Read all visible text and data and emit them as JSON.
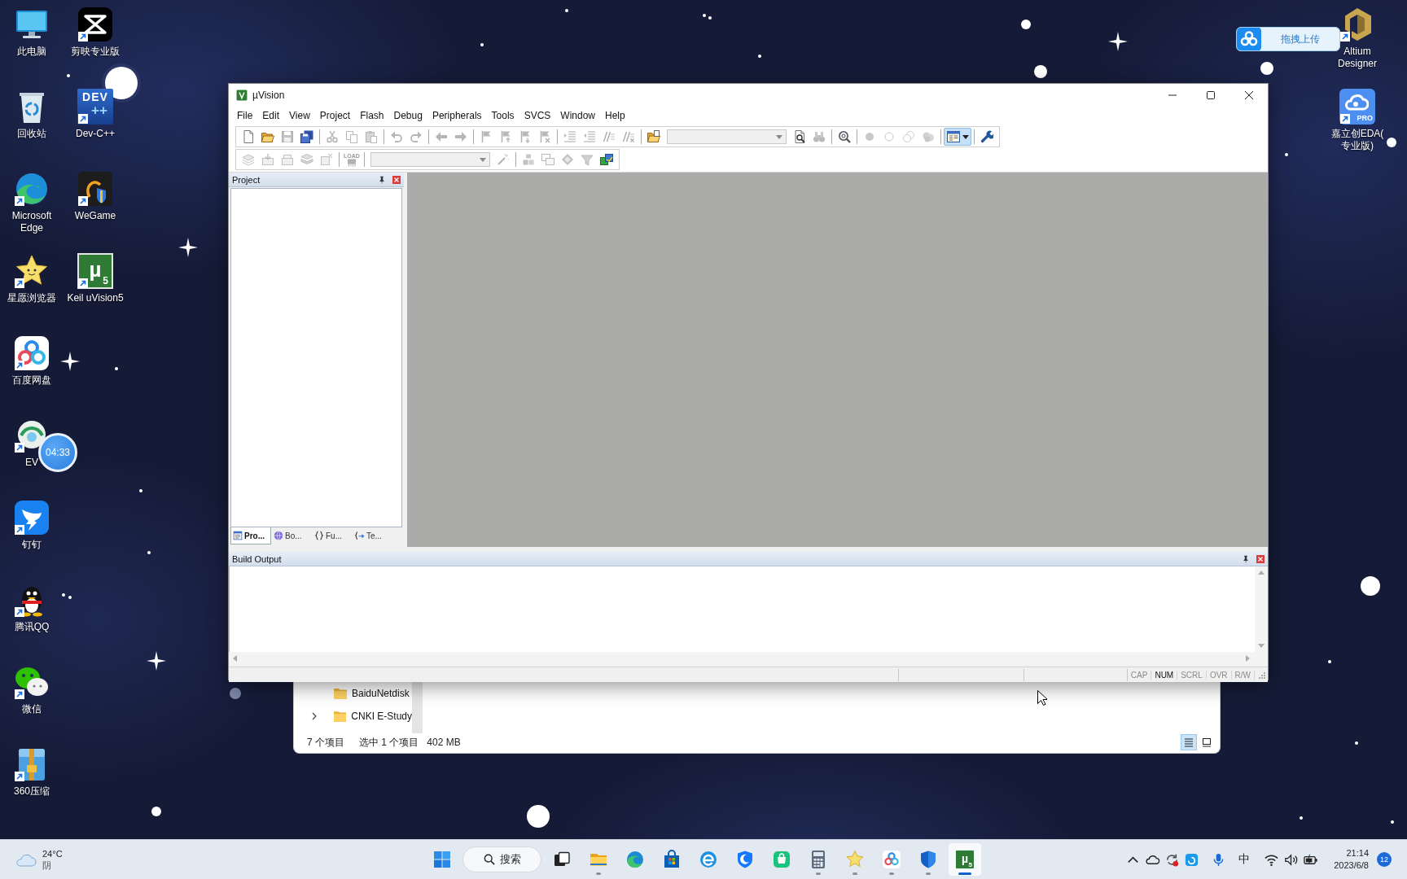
{
  "desktop": {
    "icons": [
      {
        "label": "此电脑",
        "shortcut": false
      },
      {
        "label": "回收站",
        "shortcut": false
      },
      {
        "label": "Microsoft Edge",
        "shortcut": true
      },
      {
        "label": "星愿浏览器",
        "shortcut": true
      },
      {
        "label": "百度网盘",
        "shortcut": true
      },
      {
        "label": "EV",
        "shortcut": true
      },
      {
        "label": "钉钉",
        "shortcut": true
      },
      {
        "label": "腾讯QQ",
        "shortcut": true
      },
      {
        "label": "微信",
        "shortcut": true
      },
      {
        "label": "360压缩",
        "shortcut": true
      },
      {
        "label": "剪映专业版",
        "shortcut": true
      },
      {
        "label": "Dev-C++",
        "shortcut": true,
        "logo_text": "DEV",
        "logo_subtext": "++"
      },
      {
        "label": "WeGame",
        "shortcut": true
      },
      {
        "label": "Keil uVision5",
        "shortcut": true,
        "logo_text": "µ",
        "logo_subtext": "5"
      }
    ],
    "right_icons": [
      {
        "label": "Altium Designer",
        "shortcut": true
      },
      {
        "label": "嘉立创EDA(专业版)",
        "shortcut": true,
        "logo_text": "PRO"
      }
    ],
    "upload_widget": {
      "label": "拖拽上传"
    },
    "timer": {
      "time": "04:33"
    }
  },
  "uvision": {
    "title": "µVision",
    "menu": [
      "File",
      "Edit",
      "View",
      "Project",
      "Flash",
      "Debug",
      "Peripherals",
      "Tools",
      "SVCS",
      "Window",
      "Help"
    ],
    "toolbars": [
      {
        "groups": [
          [
            {
              "kind": "button",
              "disabled": false
            },
            {
              "kind": "button",
              "disabled": false
            },
            {
              "kind": "button",
              "disabled": true
            },
            {
              "kind": "button",
              "disabled": false
            }
          ],
          [
            {
              "kind": "button",
              "disabled": true
            },
            {
              "kind": "button",
              "disabled": true
            },
            {
              "kind": "button",
              "disabled": true
            }
          ],
          [
            {
              "kind": "button",
              "disabled": true
            },
            {
              "kind": "button",
              "disabled": true
            }
          ],
          [
            {
              "kind": "button",
              "disabled": true
            },
            {
              "kind": "button",
              "disabled": true
            }
          ],
          [
            {
              "kind": "button",
              "disabled": true
            },
            {
              "kind": "button",
              "disabled": true
            },
            {
              "kind": "button",
              "disabled": true
            },
            {
              "kind": "button",
              "disabled": true
            }
          ],
          [
            {
              "kind": "button",
              "disabled": true
            },
            {
              "kind": "button",
              "disabled": true
            },
            {
              "kind": "button",
              "disabled": true
            },
            {
              "kind": "button",
              "disabled": true
            }
          ],
          [
            {
              "kind": "button",
              "disabled": false
            },
            {
              "kind": "combo",
              "disabled": true
            },
            {
              "kind": "button",
              "disabled": false
            },
            {
              "kind": "button",
              "disabled": true
            }
          ],
          [
            {
              "kind": "button",
              "disabled": false
            }
          ],
          [
            {
              "kind": "button",
              "disabled": true
            },
            {
              "kind": "button",
              "disabled": true
            },
            {
              "kind": "button",
              "disabled": true
            },
            {
              "kind": "button",
              "disabled": true
            }
          ],
          [
            {
              "kind": "dropdown",
              "disabled": false,
              "pressed": true
            }
          ],
          [
            {
              "kind": "button",
              "disabled": false
            }
          ]
        ]
      },
      {
        "groups": [
          [
            {
              "kind": "button",
              "disabled": true
            },
            {
              "kind": "button",
              "disabled": true
            },
            {
              "kind": "button",
              "disabled": true
            },
            {
              "kind": "button",
              "disabled": true
            },
            {
              "kind": "button",
              "disabled": true
            }
          ],
          [
            {
              "kind": "text_button",
              "label": "LOAD",
              "disabled": true
            }
          ],
          [
            {
              "kind": "combo",
              "disabled": true
            },
            {
              "kind": "button",
              "disabled": true
            }
          ],
          [
            {
              "kind": "button",
              "disabled": true
            },
            {
              "kind": "button",
              "disabled": true
            },
            {
              "kind": "button",
              "disabled": true
            },
            {
              "kind": "button",
              "disabled": true
            },
            {
              "kind": "button",
              "disabled": false
            }
          ]
        ]
      }
    ],
    "project_panel": {
      "title": "Project",
      "tabs": [
        {
          "label": "Pro...",
          "selected": true
        },
        {
          "label": "Bo...",
          "selected": false
        },
        {
          "label": "Fu...",
          "selected": false
        },
        {
          "label": "Te...",
          "selected": false
        }
      ]
    },
    "build_output": {
      "title": "Build Output"
    },
    "status_indicators": [
      {
        "label": "CAP",
        "on": false
      },
      {
        "label": "NUM",
        "on": true
      },
      {
        "label": "SCRL",
        "on": false
      },
      {
        "label": "OVR",
        "on": false
      },
      {
        "label": "R/W",
        "on": false
      }
    ]
  },
  "explorer": {
    "folders": [
      {
        "name": "BaiduNetdisk",
        "expandable": false
      },
      {
        "name": "CNKI E-Study",
        "expandable": true
      }
    ],
    "item_count": "7 个项目",
    "selection": "选中 1 个项目",
    "selection_size": "402 MB",
    "views": [
      {
        "selected": true
      },
      {
        "selected": false
      }
    ]
  },
  "taskbar": {
    "weather": {
      "temperature": "24°C",
      "condition": "阴"
    },
    "search": {
      "label": "搜索"
    },
    "apps": [
      {
        "running": true,
        "active": false
      },
      {
        "running": false,
        "active": false
      },
      {
        "running": false,
        "active": false
      },
      {
        "running": false,
        "active": false
      },
      {
        "running": false,
        "active": false
      },
      {
        "running": false,
        "active": false
      },
      {
        "running": true,
        "active": false
      },
      {
        "running": true,
        "active": false
      },
      {
        "running": true,
        "active": false
      },
      {
        "running": true,
        "active": false
      },
      {
        "running": true,
        "active": true,
        "logo_text": "µ",
        "logo_subtext": "5"
      }
    ],
    "tray": {
      "ime": "中",
      "time": "21:14",
      "date": "2023/6/8",
      "notification_count": "12"
    }
  }
}
